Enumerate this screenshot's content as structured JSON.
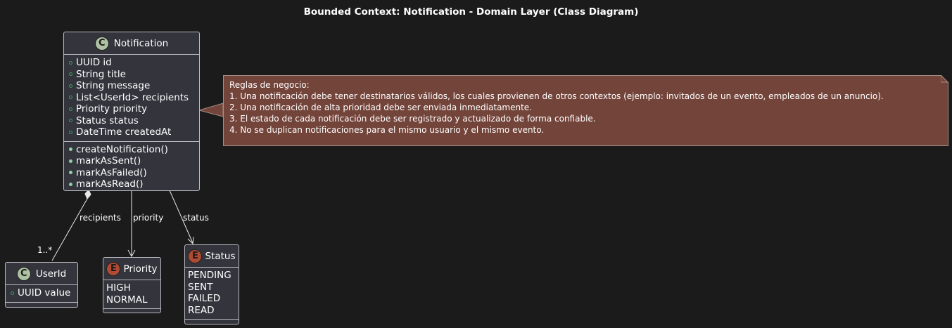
{
  "diagram": {
    "title": "Bounded Context: Notification - Domain Layer (Class Diagram)"
  },
  "classes": {
    "notification": {
      "stereotype_letter": "C",
      "name": "Notification",
      "attributes": [
        "UUID id",
        "String title",
        "String message",
        "List<UserId> recipients",
        "Priority priority",
        "Status status",
        "DateTime createdAt"
      ],
      "methods": [
        "createNotification()",
        "markAsSent()",
        "markAsFailed()",
        "markAsRead()"
      ]
    },
    "userid": {
      "stereotype_letter": "C",
      "name": "UserId",
      "attributes": [
        "UUID value"
      ]
    },
    "priority": {
      "stereotype_letter": "E",
      "name": "Priority",
      "literals": [
        "HIGH",
        "NORMAL"
      ]
    },
    "status": {
      "stereotype_letter": "E",
      "name": "Status",
      "literals": [
        "PENDING",
        "SENT",
        "FAILED",
        "READ"
      ]
    }
  },
  "note": {
    "lines": [
      "Reglas de negocio:",
      "1. Una notificación debe tener destinatarios válidos, los cuales provienen de otros contextos (ejemplo: invitados de un evento, empleados de un anuncio).",
      "2. Una notificación de alta prioridad debe ser enviada inmediatamente.",
      "3. El estado de cada notificación debe ser registrado y actualizado de forma confiable.",
      "4. No se duplican notificaciones para el mismo usuario y el mismo evento."
    ]
  },
  "relations": {
    "recipients": {
      "label": "recipients",
      "multiplicity": "1..*"
    },
    "priority": {
      "label": "priority"
    },
    "status": {
      "label": "status"
    }
  },
  "colors": {
    "background": "#1b1b1b",
    "class_fill": "#33343c",
    "border": "#b9b9c2",
    "class_badge": "#adc1a3",
    "enum_badge": "#b04a32",
    "note_fill": "#73443a",
    "visibility_public": "#8fd2a6"
  }
}
